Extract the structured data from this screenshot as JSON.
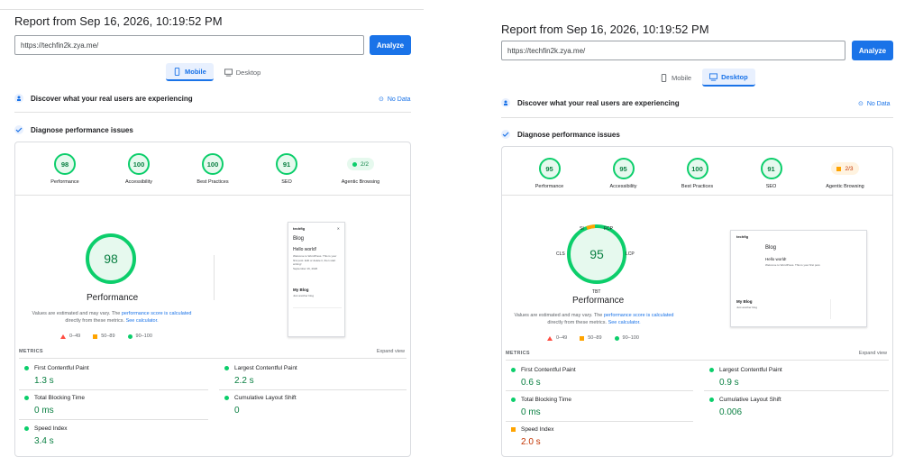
{
  "left": {
    "report_title": "Report from Sep 16, 2026, 10:19:52 PM",
    "url": "https://techfin2k.zya.me/",
    "analyze_label": "Analyze",
    "tabs": [
      {
        "label": "Mobile",
        "active": true
      },
      {
        "label": "Desktop",
        "active": false
      }
    ],
    "discover_label": "Discover what your real users are experiencing",
    "no_data_label": "No Data",
    "diagnose_label": "Diagnose performance issues",
    "gauges": [
      {
        "score": "98",
        "label": "Performance"
      },
      {
        "score": "100",
        "label": "Accessibility"
      },
      {
        "score": "100",
        "label": "Best Practices"
      },
      {
        "score": "91",
        "label": "SEO"
      },
      {
        "score": "2/2",
        "label": "Agentic Browsing",
        "pill": true
      }
    ],
    "big_score": "98",
    "big_label": "Performance",
    "note_1": "Values are estimated and may vary. The",
    "note_link_1": "performance score is calculated",
    "note_2": "directly from these metrics.",
    "note_link_2": "See calculator.",
    "legend": [
      "0–49",
      "50–89",
      "90–100"
    ],
    "thumb": {
      "site": "techfig",
      "blog": "Blog",
      "post": "Hello world!",
      "body": "Welcome to WordPress. This is your first post. Edit or delete it, then start writing!",
      "date": "September 16, 2026",
      "myblog": "My Blog",
      "tagline": "Just another blog"
    },
    "metrics_label": "METRICS",
    "expand_label": "Expand view",
    "metrics": [
      {
        "name": "First Contentful Paint",
        "value": "1.3 s",
        "status": "good"
      },
      {
        "name": "Largest Contentful Paint",
        "value": "2.2 s",
        "status": "good"
      },
      {
        "name": "Total Blocking Time",
        "value": "0 ms",
        "status": "good"
      },
      {
        "name": "Cumulative Layout Shift",
        "value": "0",
        "status": "good"
      },
      {
        "name": "Speed Index",
        "value": "3.4 s",
        "status": "good"
      }
    ]
  },
  "right": {
    "report_title": "Report from Sep 16, 2026, 10:19:52 PM",
    "url": "https://techfin2k.zya.me/",
    "analyze_label": "Analyze",
    "tabs": [
      {
        "label": "Mobile",
        "active": false
      },
      {
        "label": "Desktop",
        "active": true
      }
    ],
    "discover_label": "Discover what your real users are experiencing",
    "no_data_label": "No Data",
    "diagnose_label": "Diagnose performance issues",
    "gauges": [
      {
        "score": "95",
        "label": "Performance"
      },
      {
        "score": "95",
        "label": "Accessibility"
      },
      {
        "score": "100",
        "label": "Best Practices"
      },
      {
        "score": "91",
        "label": "SEO"
      },
      {
        "score": "2/3",
        "label": "Agentic Browsing",
        "pill": true,
        "status": "average"
      }
    ],
    "big_score": "95",
    "big_label": "Performance",
    "ring_labels": {
      "si": "SI",
      "fcp": "FCP",
      "lcp": "LCP",
      "tbt": "TBT",
      "cls": "CLS"
    },
    "note_1": "Values are estimated and may vary. The",
    "note_link_1": "performance score is calculated",
    "note_2": "directly from these metrics.",
    "note_link_2": "See calculator.",
    "legend": [
      "0–49",
      "50–89",
      "90–100"
    ],
    "thumb": {
      "site": "techfig",
      "blog": "Blog",
      "post": "Hello world!",
      "body": "Welcome to WordPress. This is your first post.",
      "myblog": "My Blog",
      "tagline": "Just another blog"
    },
    "metrics_label": "METRICS",
    "expand_label": "Expand view",
    "metrics": [
      {
        "name": "First Contentful Paint",
        "value": "0.6 s",
        "status": "good"
      },
      {
        "name": "Largest Contentful Paint",
        "value": "0.9 s",
        "status": "good"
      },
      {
        "name": "Total Blocking Time",
        "value": "0 ms",
        "status": "good"
      },
      {
        "name": "Cumulative Layout Shift",
        "value": "0.006",
        "status": "good"
      },
      {
        "name": "Speed Index",
        "value": "2.0 s",
        "status": "average"
      }
    ]
  },
  "colors": {
    "accent": "#1a73e8",
    "good": "#0cce6b",
    "average": "#ffa400",
    "poor": "#ff4e42"
  }
}
